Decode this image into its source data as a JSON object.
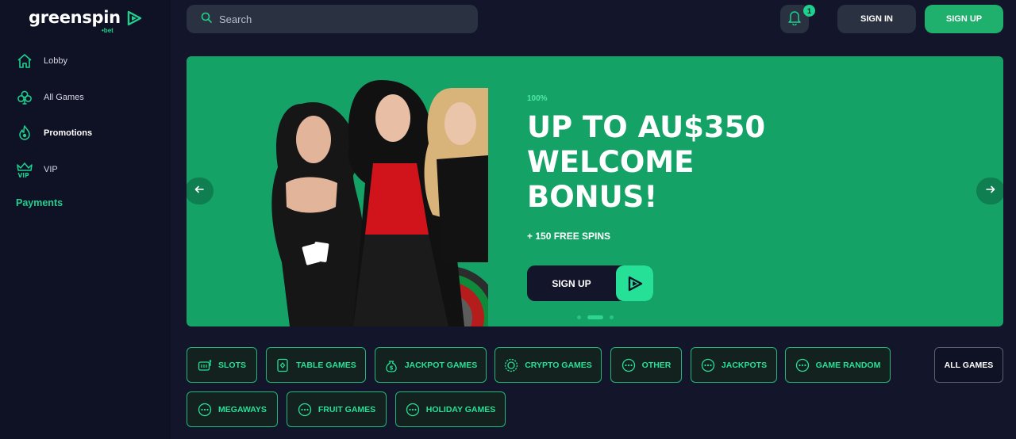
{
  "brand": {
    "name": "greenspin",
    "suffix": "•bet",
    "accent": "#1fd18e"
  },
  "sidebar": {
    "items": [
      {
        "label": "Lobby",
        "icon": "home-icon"
      },
      {
        "label": "All Games",
        "icon": "club-icon"
      },
      {
        "label": "Promotions",
        "icon": "fire-icon"
      },
      {
        "label": "VIP",
        "icon": "crown-icon"
      }
    ],
    "payments_label": "Payments"
  },
  "header": {
    "search_placeholder": "Search",
    "notification_count": "1",
    "signin_label": "SIGN IN",
    "signup_label": "SIGN UP"
  },
  "banner": {
    "kicker": "100%",
    "title": "UP TO AU$350 WELCOME BONUS!",
    "subtitle": "+ 150 FREE SPINS",
    "cta_label": "SIGN UP",
    "slides": 3,
    "active_slide": 2
  },
  "categories": [
    {
      "label": "SLOTS",
      "icon": "slot-machine-icon"
    },
    {
      "label": "TABLE GAMES",
      "icon": "card-icon"
    },
    {
      "label": "JACKPOT GAMES",
      "icon": "money-bag-icon"
    },
    {
      "label": "CRYPTO GAMES",
      "icon": "coin-icon"
    },
    {
      "label": "OTHER",
      "icon": "dots-icon"
    },
    {
      "label": "JACKPOTS",
      "icon": "dots-icon"
    },
    {
      "label": "GAME RANDOM",
      "icon": "dots-icon"
    },
    {
      "label": "MEGAWAYS",
      "icon": "dots-icon"
    },
    {
      "label": "FRUIT GAMES",
      "icon": "dots-icon"
    },
    {
      "label": "HOLIDAY GAMES",
      "icon": "dots-icon"
    }
  ],
  "all_games_label": "ALL GAMES"
}
